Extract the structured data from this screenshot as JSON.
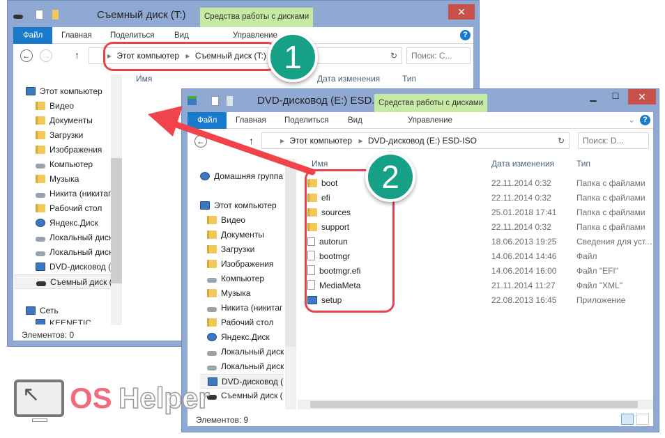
{
  "back_window": {
    "title": "Съемный диск (T:)",
    "context_tab": "Средства работы с дисками",
    "tabs": [
      "Файл",
      "Главная",
      "Поделиться",
      "Вид",
      "Управление"
    ],
    "breadcrumb": [
      "Этот компьютер",
      "Съемный диск (T:)"
    ],
    "search_placeholder": "Поиск: С...",
    "columns": [
      "Имя",
      "Дата изменения",
      "Тип"
    ],
    "nav": [
      "Этот компьютер",
      "Видео",
      "Документы",
      "Загрузки",
      "Изображения",
      "Компьютер",
      "Музыка",
      "Никита (никитаг",
      "Рабочий стол",
      "Яндекс.Диск",
      "Локальный диск",
      "Локальный диск",
      "DVD-дисковод (E",
      "Съемный диск (",
      "Сеть",
      "KEENETIC"
    ],
    "status": "Элементов: 0"
  },
  "front_window": {
    "title": "DVD-дисковод (E:) ESD...",
    "context_tab": "Средства работы с дисками",
    "tabs": [
      "Файл",
      "Главная",
      "Поделиться",
      "Вид",
      "Управление"
    ],
    "breadcrumb": [
      "Этот компьютер",
      "DVD-дисковод (E:) ESD-ISO"
    ],
    "search_placeholder": "Поиск: D...",
    "columns": [
      "Имя",
      "Дата изменения",
      "Тип"
    ],
    "nav": [
      "Домашняя группа",
      "Этот компьютер",
      "Видео",
      "Документы",
      "Загрузки",
      "Изображения",
      "Компьютер",
      "Музыка",
      "Никита (никитаг",
      "Рабочий стол",
      "Яндекс.Диск",
      "Локальный диск",
      "Локальный диск",
      "DVD-дисковод (E",
      "Съемный диск ("
    ],
    "files": [
      {
        "name": "boot",
        "date": "22.11.2014 0:32",
        "type": "Папка с файлами",
        "icon": "folder"
      },
      {
        "name": "efi",
        "date": "22.11.2014 0:32",
        "type": "Папка с файлами",
        "icon": "folder"
      },
      {
        "name": "sources",
        "date": "25.01.2018 17:41",
        "type": "Папка с файлами",
        "icon": "folder"
      },
      {
        "name": "support",
        "date": "22.11.2014 0:32",
        "type": "Папка с файлами",
        "icon": "folder"
      },
      {
        "name": "autorun",
        "date": "18.06.2013 19:25",
        "type": "Сведения для уст...",
        "icon": "settings-file"
      },
      {
        "name": "bootmgr",
        "date": "14.06.2014 14:46",
        "type": "Файл",
        "icon": "file"
      },
      {
        "name": "bootmgr.efi",
        "date": "14.06.2014 16:00",
        "type": "Файл \"EFI\"",
        "icon": "file"
      },
      {
        "name": "MediaMeta",
        "date": "21.11.2014 11:27",
        "type": "Файл \"XML\"",
        "icon": "file"
      },
      {
        "name": "setup",
        "date": "22.08.2013 16:45",
        "type": "Приложение",
        "icon": "setup-app"
      }
    ],
    "status": "Элементов: 9"
  },
  "badges": [
    "1",
    "2"
  ],
  "logo": {
    "text_a": "OS",
    "text_b": "Helper"
  },
  "colors": {
    "accent": "#1979ca",
    "badge": "#16a085",
    "highlight": "#e8434c",
    "frame": "#8fa9d3",
    "context": "#c5eaa3"
  }
}
